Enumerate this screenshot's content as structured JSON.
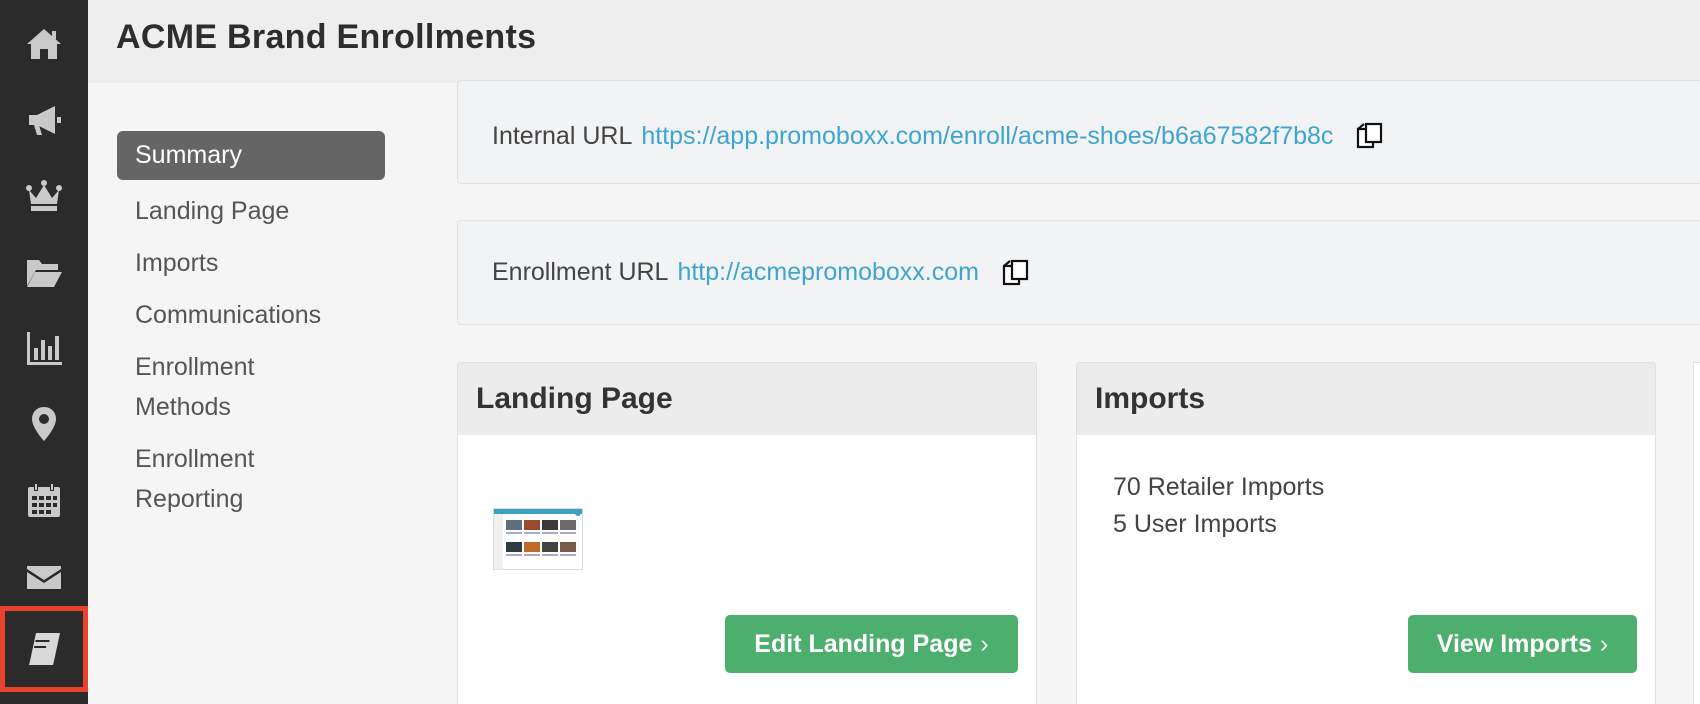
{
  "header": {
    "title": "ACME Brand Enrollments"
  },
  "rail": {
    "items": [
      {
        "icon": "home-icon"
      },
      {
        "icon": "megaphone-icon"
      },
      {
        "icon": "crown-icon"
      },
      {
        "icon": "folder-open-icon"
      },
      {
        "icon": "bar-chart-icon"
      },
      {
        "icon": "map-pin-icon"
      },
      {
        "icon": "calendar-icon"
      },
      {
        "icon": "envelope-icon"
      },
      {
        "icon": "book-icon",
        "active": true
      }
    ],
    "active_color": "#e8412c"
  },
  "subnav": {
    "summary": "Summary",
    "landing_page": "Landing Page",
    "imports": "Imports",
    "communications": "Communications",
    "enrollment_methods_1": "Enrollment",
    "enrollment_methods_2": "Methods",
    "enrollment_reporting_1": "Enrollment",
    "enrollment_reporting_2": "Reporting"
  },
  "internal_url": {
    "label": "Internal URL",
    "url": "https://app.promoboxx.com/enroll/acme-shoes/b6a67582f7b8c"
  },
  "enrollment_url": {
    "label": "Enrollment URL",
    "url": "http://acmepromoboxx.com"
  },
  "landing_card": {
    "title": "Landing Page",
    "button": "Edit Landing Page"
  },
  "imports_card": {
    "title": "Imports",
    "retailer_imports": "70 Retailer Imports",
    "user_imports": "5 User Imports",
    "button": "View Imports"
  },
  "colors": {
    "rail_bg": "#2b2b2b",
    "link": "#3fa5cf",
    "button": "#4caf6d",
    "subnav_active": "#656565"
  }
}
